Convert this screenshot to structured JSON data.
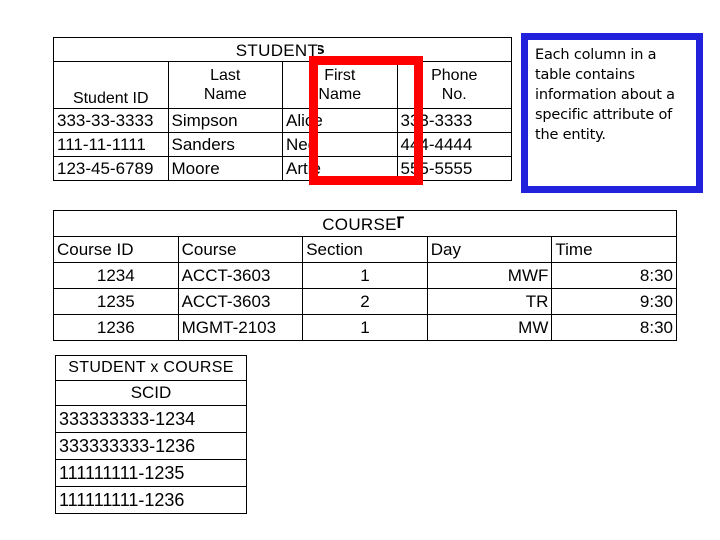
{
  "student_table": {
    "title": "STUDENT",
    "title_artifact": "s",
    "columns": [
      "Student ID",
      "Last Name",
      "First Name",
      "Phone No."
    ],
    "columns_wrapped": [
      [
        "Student ID"
      ],
      [
        "Last",
        "Name"
      ],
      [
        "First",
        "Name"
      ],
      [
        "Phone",
        "No."
      ]
    ],
    "rows": [
      [
        "333-33-3333",
        "Simpson",
        "Alice",
        "333-3333"
      ],
      [
        "111-11-1111",
        "Sanders",
        "Ned",
        "444-4444"
      ],
      [
        "123-45-6789",
        "Moore",
        "Artie",
        "555-5555"
      ]
    ],
    "highlight": {
      "column": "First Name",
      "color": "#FF0000"
    }
  },
  "note": {
    "text": "Each column in a table contains information about a specific attribute of the entity.",
    "border_color": "#2222DD"
  },
  "course_table": {
    "title": "COURSE",
    "title_artifact": "T",
    "columns": [
      "Course ID",
      "Course",
      "Section",
      "Day",
      "Time"
    ],
    "rows": [
      [
        "1234",
        "ACCT-3603",
        "1",
        "MWF",
        "8:30"
      ],
      [
        "1235",
        "ACCT-3603",
        "2",
        "TR",
        "9:30"
      ],
      [
        "1236",
        "MGMT-2103",
        "1",
        "MW",
        "8:30"
      ]
    ]
  },
  "student_course_table": {
    "title": "STUDENT x COURSE",
    "columns": [
      "SCID"
    ],
    "rows": [
      [
        "333333333-1234"
      ],
      [
        "333333333-1236"
      ],
      [
        "111111111-1235"
      ],
      [
        "111111111-1236"
      ]
    ]
  }
}
